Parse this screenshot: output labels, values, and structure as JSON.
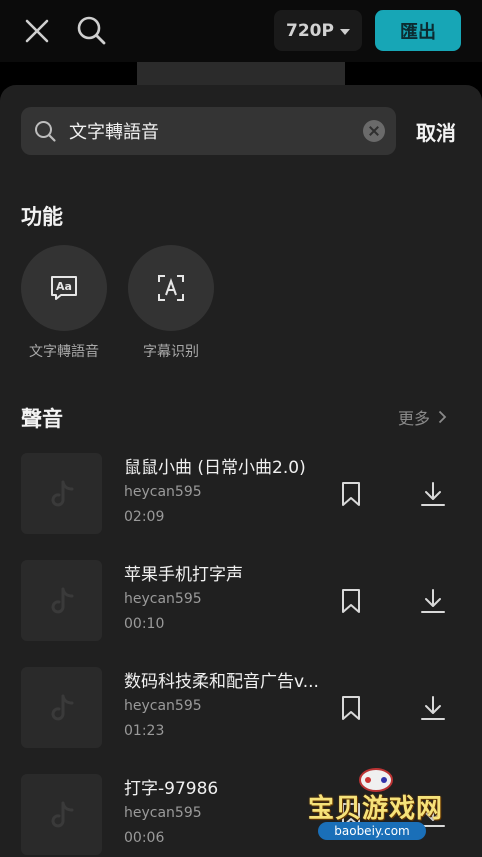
{
  "topbar": {
    "resolution": "720P",
    "export_label": "匯出",
    "close_icon": "close-icon",
    "search_icon": "search-icon"
  },
  "search": {
    "value": "文字轉語音",
    "cancel_label": "取消"
  },
  "functions": {
    "title": "功能",
    "items": [
      {
        "label": "文字轉語音",
        "icon": "text-to-speech-icon"
      },
      {
        "label": "字幕识别",
        "icon": "subtitle-recognition-icon"
      }
    ]
  },
  "sounds": {
    "title": "聲音",
    "more_label": "更多",
    "tracks": [
      {
        "title": "鼠鼠小曲 (日常小曲2.0)",
        "author": "heycan595",
        "duration": "02:09"
      },
      {
        "title": "苹果手机打字声",
        "author": "heycan595",
        "duration": "00:10"
      },
      {
        "title": "数码科技柔和配音广告v...",
        "author": "heycan595",
        "duration": "01:23"
      },
      {
        "title": "打字-97986",
        "author": "heycan595",
        "duration": "00:06"
      }
    ]
  },
  "watermark": {
    "text": "宝贝游戏网",
    "url": "baobeiy.com"
  },
  "colors": {
    "accent": "#17a6b6",
    "sheet_bg": "#202020",
    "background": "#000000"
  }
}
